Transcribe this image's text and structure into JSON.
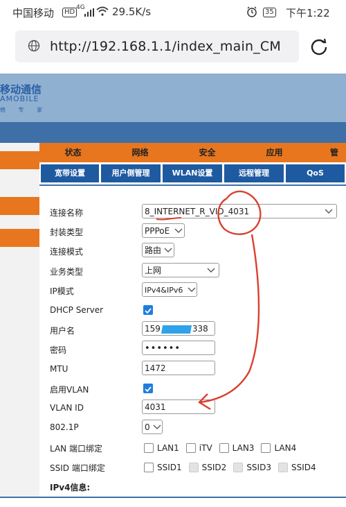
{
  "status_bar": {
    "carrier": "中国移动",
    "hd": "HD",
    "signal": "4G",
    "speed": "29.5K/s",
    "battery": "35",
    "time": "下午1:22"
  },
  "browser": {
    "url": "http://192.168.1.1/index_main_CM"
  },
  "router": {
    "logo_cn": "移动通信",
    "logo_en": "AMOBILE",
    "logo_sub": "络 专 家",
    "main_nav": [
      "状态",
      "网络",
      "安全",
      "应用",
      "管"
    ],
    "sub_nav": [
      "宽带设置",
      "用户侧管理",
      "WLAN设置",
      "远程管理",
      "QoS"
    ],
    "form": {
      "connection_name_label": "连接名称",
      "connection_name": "8_INTERNET_R_VID_4031",
      "encapsulation_label": "封装类型",
      "encapsulation": "PPPoE",
      "mode_label": "连接模式",
      "mode": "路由",
      "service_label": "业务类型",
      "service": "上网",
      "ip_mode_label": "IP模式",
      "ip_mode": "IPv4&IPv6",
      "dhcp_label": "DHCP Server",
      "username_label": "用户名",
      "username_prefix": "159",
      "username_suffix": "338",
      "password_label": "密码",
      "password": "••••••",
      "mtu_label": "MTU",
      "mtu": "1472",
      "vlan_enable_label": "启用VLAN",
      "vlan_id_label": "VLAN ID",
      "vlan_id": "4031",
      "p8021_label": "802.1P",
      "p8021": "0",
      "lan_bind_label": "LAN 端口绑定",
      "lan_ports": [
        "LAN1",
        "iTV",
        "LAN3",
        "LAN4"
      ],
      "ssid_bind_label": "SSID 端口绑定",
      "ssids": [
        "SSID1",
        "SSID2",
        "SSID3",
        "SSID4"
      ],
      "ipv4_info_label": "IPv4信息:"
    }
  },
  "colors": {
    "accent_orange": "#e8761e",
    "nav_blue": "#1e5aa0",
    "annotation_red": "#d9402f"
  }
}
